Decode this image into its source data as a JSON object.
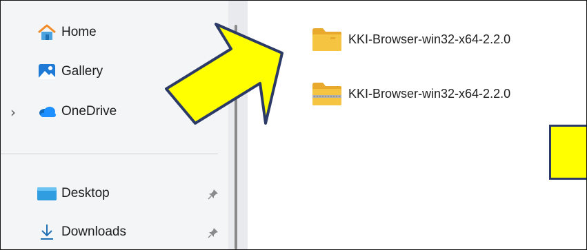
{
  "navigation": {
    "items": [
      {
        "label": "Home",
        "icon": "home-icon"
      },
      {
        "label": "Gallery",
        "icon": "gallery-icon"
      },
      {
        "label": "OneDrive",
        "icon": "onedrive-cloud-icon",
        "expandable": true
      },
      {
        "label": "Desktop",
        "icon": "desktop-folder-icon",
        "pinned": true
      },
      {
        "label": "Downloads",
        "icon": "download-arrow-icon",
        "pinned": true
      }
    ]
  },
  "files": [
    {
      "name": "KKI-Browser-win32-x64-2.2.0",
      "icon": "folder-icon"
    },
    {
      "name": "KKI-Browser-win32-x64-2.2.0",
      "icon": "zip-folder-icon"
    }
  ],
  "colors": {
    "annotation_fill": "#ffff00",
    "annotation_stroke": "#2b3a67",
    "folder": "#f5c542",
    "nav_background": "#f4f5f7"
  }
}
